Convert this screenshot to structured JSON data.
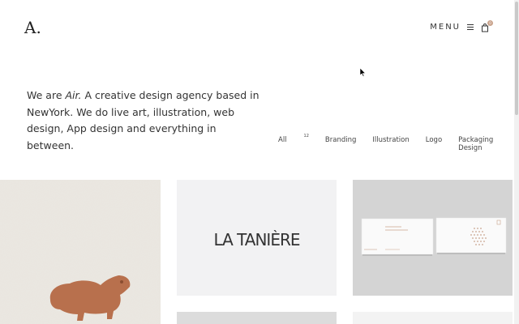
{
  "header": {
    "logo": "A.",
    "menu_label": "MENU",
    "cart_count": "0"
  },
  "intro": {
    "prefix": "We are ",
    "brand": "Air.",
    "rest": " A creative design agency based in NewYork. We do live art, illustration, web design, App design and everything in between."
  },
  "filters": {
    "items": [
      {
        "label": "All",
        "count": "12"
      },
      {
        "label": "Branding"
      },
      {
        "label": "Illustration"
      },
      {
        "label": "Logo"
      },
      {
        "label": "Packaging Design"
      }
    ]
  },
  "portfolio": {
    "card2_logo": "LA TANIÈRE"
  },
  "colors": {
    "accent": "#c9a38c",
    "copper": "#b8704d"
  }
}
